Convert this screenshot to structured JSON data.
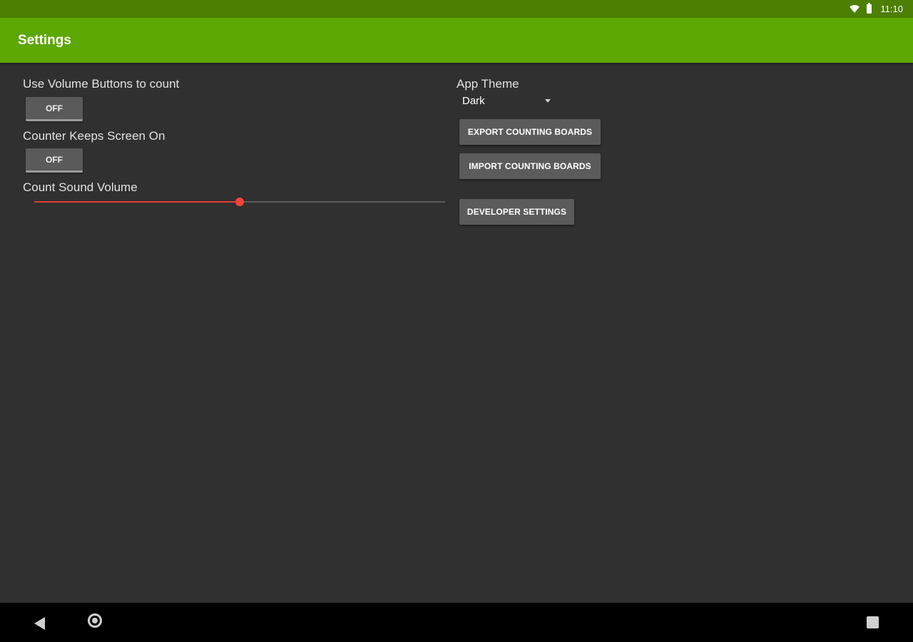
{
  "status_bar": {
    "time": "11:10",
    "icons": [
      "wifi-icon",
      "battery-icon"
    ]
  },
  "app_bar": {
    "title": "Settings",
    "color": "#5da701",
    "status_color": "#4c7f02"
  },
  "settings": {
    "volume_buttons": {
      "label": "Use Volume Buttons to count",
      "toggle_label": "OFF"
    },
    "screen_on": {
      "label": "Counter Keeps Screen On",
      "toggle_label": "OFF"
    },
    "sound_volume": {
      "label": "Count Sound Volume",
      "value_fraction": 0.5,
      "accent": "#e53935"
    },
    "app_theme": {
      "label": "App Theme",
      "selected": "Dark"
    }
  },
  "buttons": {
    "export": "EXPORT COUNTING BOARDS",
    "import": "IMPORT COUNTING BOARDS",
    "developer": "DEVELOPER SETTINGS"
  },
  "nav_bar": {
    "icons": [
      "back-icon",
      "home-icon",
      "recents-icon"
    ]
  }
}
